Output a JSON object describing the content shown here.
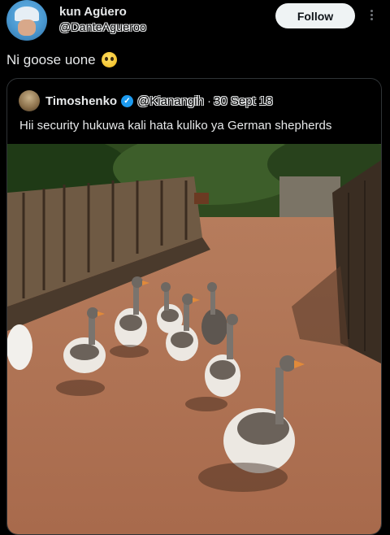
{
  "post": {
    "display_name": "kun Agüero",
    "handle": "@DanteAgueroo",
    "follow_label": "Follow",
    "text": "Ni goose uone",
    "emoji": "pleading-face-emoji"
  },
  "quote": {
    "display_name": "Timoshenko",
    "handle": "@Kianangih",
    "separator": "·",
    "date": "30 Sept 18",
    "text": "Hii security hukuwa kali hata kuliko ya  German shepherds"
  },
  "colors": {
    "background": "#000000",
    "text": "#e7e9ea",
    "button_bg": "#eff3f4",
    "verified": "#1d9bf0",
    "border": "#2f3336"
  },
  "icons": [
    "more-icon",
    "verified-icon"
  ]
}
